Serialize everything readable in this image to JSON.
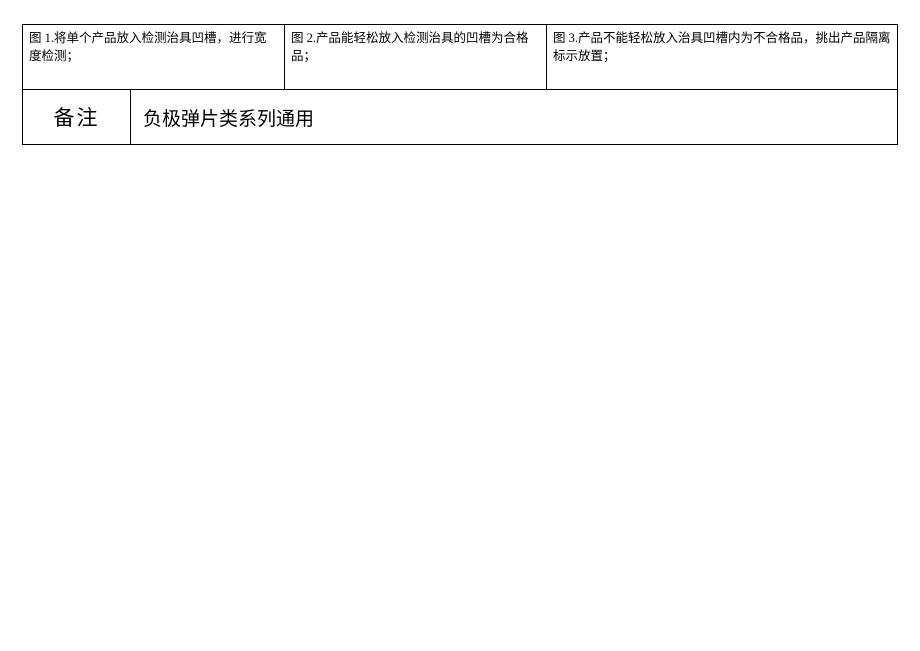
{
  "figures": {
    "fig1": "图 1.将单个产品放入检测治具凹槽，进行宽度检测；",
    "fig2": "图 2.产品能轻松放入检测治具的凹槽为合格品；",
    "fig3": "图 3.产品不能轻松放入治具凹槽内为不合格品，挑出产品隔离标示放置；"
  },
  "remarks": {
    "label": "备注",
    "value": "负极弹片类系列通用"
  }
}
